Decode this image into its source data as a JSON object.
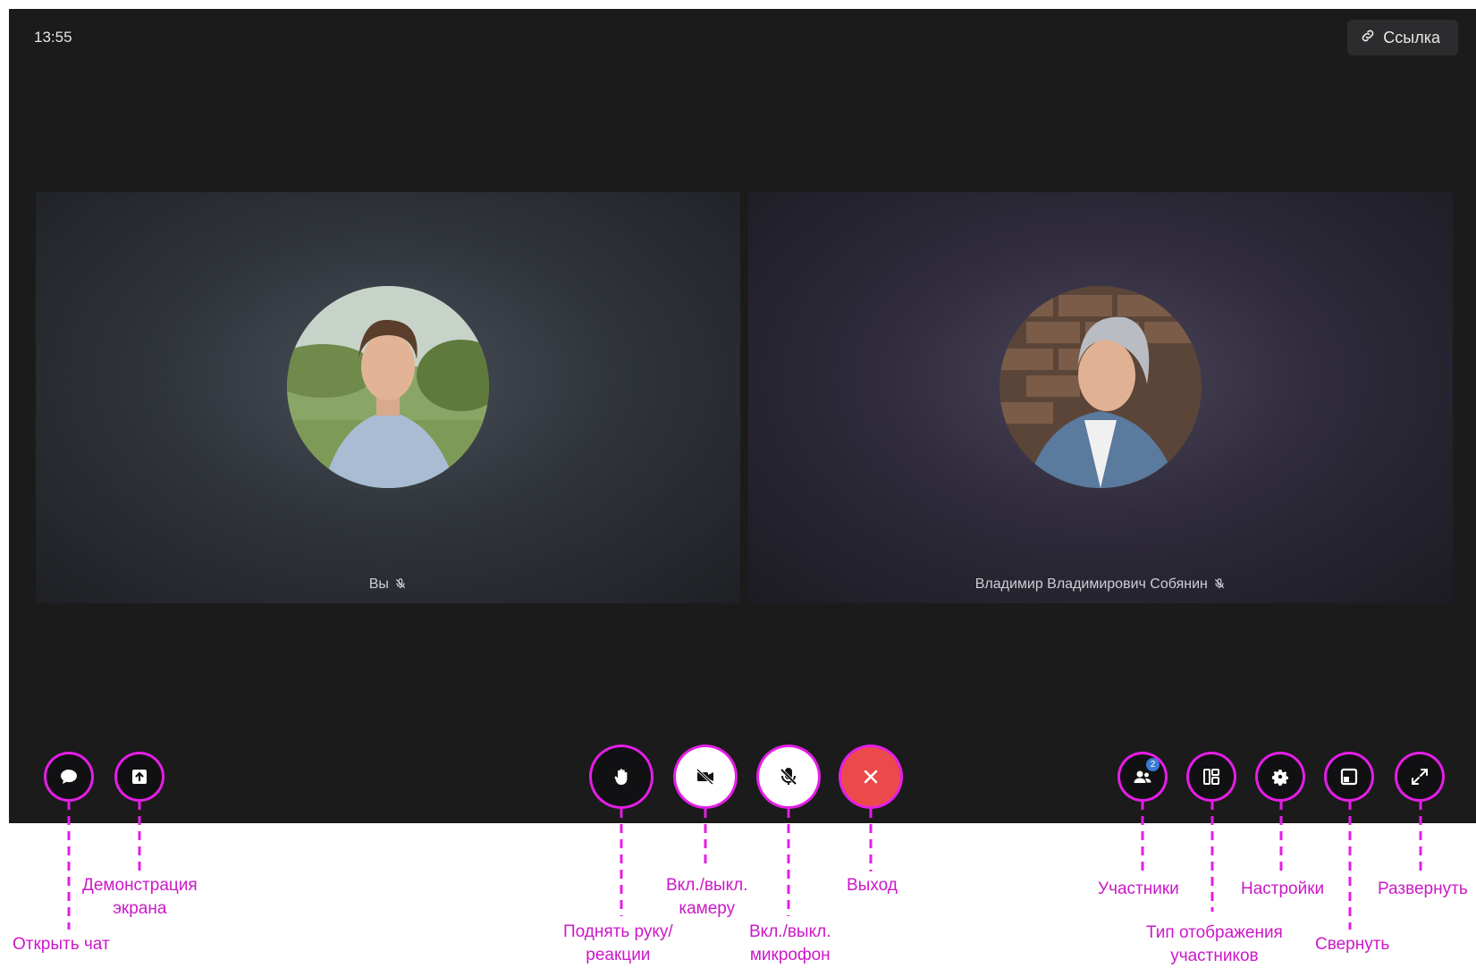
{
  "header": {
    "time": "13:55",
    "link_label": "Ссылка"
  },
  "tiles": [
    {
      "name": "Вы"
    },
    {
      "name": "Владимир Владимирович Собянин"
    }
  ],
  "participants_count": "2",
  "callouts": {
    "open_chat": "Открыть чат",
    "screen_share_1": "Демонстрация",
    "screen_share_2": "экрана",
    "raise_hand_1": "Поднять руку/",
    "raise_hand_2": "реакции",
    "camera_1": "Вкл./выкл.",
    "camera_2": "камеру",
    "mic_1": "Вкл./выкл.",
    "mic_2": "микрофон",
    "exit": "Выход",
    "participants": "Участники",
    "layout_1": "Тип отображения",
    "layout_2": "участников",
    "settings": "Настройки",
    "minimize": "Свернуть",
    "expand": "Развернуть"
  },
  "icons": {
    "chat": "chat-icon",
    "share": "screen-share-icon",
    "hand": "hand-icon",
    "camera": "camera-off-icon",
    "mic": "mic-off-icon",
    "exit": "close-icon",
    "participants": "participants-icon",
    "layout": "layout-icon",
    "settings": "gear-icon",
    "minimize": "minimize-icon",
    "expand": "expand-icon"
  },
  "colors": {
    "accent": "#e51ee6",
    "exit": "#ea4a4a",
    "badge": "#3a7bd5"
  }
}
